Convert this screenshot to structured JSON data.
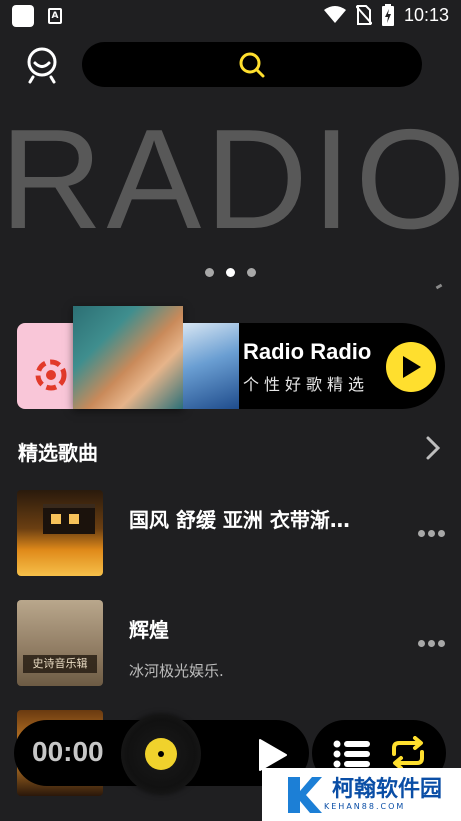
{
  "status_bar": {
    "time": "10:13",
    "icons": [
      "app-square-icon",
      "a-badge-icon",
      "wifi-icon",
      "no-sim-icon",
      "battery-charging-icon"
    ]
  },
  "header": {
    "avatar_icon": "user-avatar-icon",
    "search_icon": "search-icon",
    "accent_color": "#ffdf2e"
  },
  "banner": {
    "text": "RADIO",
    "page_count": 3,
    "active_index": 1
  },
  "radio_card": {
    "title": "Radio Radio",
    "subtitle": "个性好歌精选",
    "play_icon": "play-icon"
  },
  "section": {
    "title": "精选歌曲",
    "more_icon": "chevron-right-icon"
  },
  "songs": [
    {
      "title": "国风 舒缓 亚洲 衣带渐…",
      "artist": ""
    },
    {
      "title": "辉煌",
      "artist": "冰河极光娱乐.",
      "cover_label": "史诗音乐辑"
    },
    {
      "title": "",
      "artist": ""
    }
  ],
  "player": {
    "time": "00:00",
    "play_icon": "play-icon",
    "playlist_icon": "playlist-icon",
    "repeat_icon": "repeat-icon"
  },
  "watermark": {
    "name": "柯翰软件园",
    "url": "KEHAN88.COM"
  }
}
